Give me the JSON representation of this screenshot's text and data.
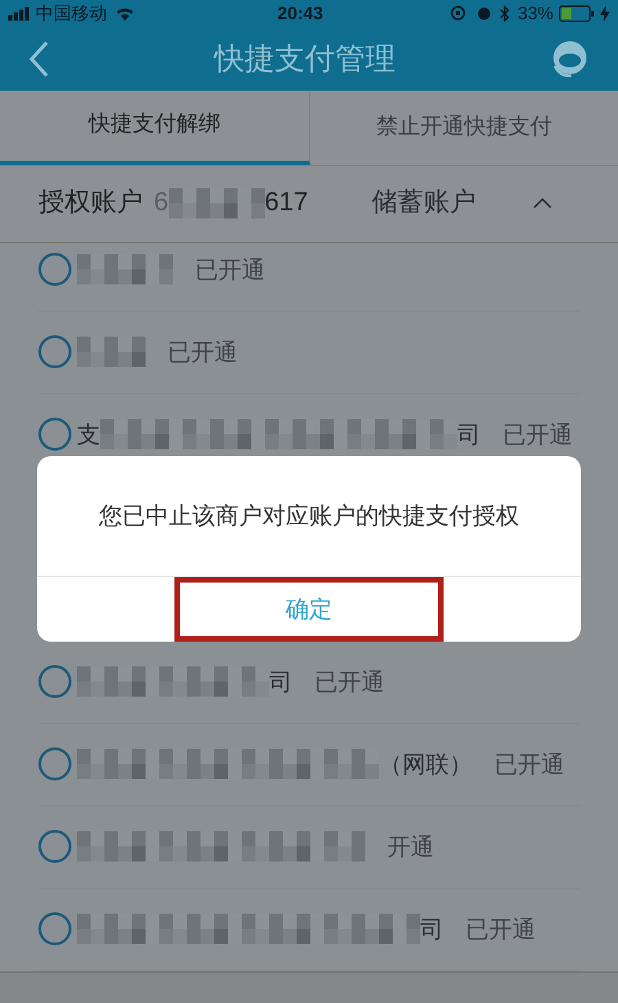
{
  "status_bar": {
    "carrier": "中国移动",
    "time": "20:43",
    "battery": "33%"
  },
  "header": {
    "title": "快捷支付管理"
  },
  "tabs": [
    {
      "label": "快捷支付解绑",
      "selected": true
    },
    {
      "label": "禁止开通快捷支付",
      "selected": false
    }
  ],
  "account": {
    "label": "授权账户",
    "number_start": "6",
    "number_end": "617",
    "type": "储蓄账户",
    "expanded": true
  },
  "merchants": [
    {
      "kind": "row",
      "status": "已开通",
      "selected": false
    },
    {
      "kind": "row",
      "status": "已开通",
      "selected": false
    },
    {
      "kind": "row",
      "name_start": "支",
      "name_end": "司",
      "status": "已开通",
      "selected": false
    },
    {
      "kind": "hidden"
    },
    {
      "kind": "hidden"
    },
    {
      "kind": "row",
      "name_end": "司",
      "status": "已开通",
      "selected": false
    },
    {
      "kind": "row",
      "name_end": "（网联）",
      "status": "已开通",
      "selected": false
    },
    {
      "kind": "row",
      "status": "开通",
      "selected": false
    },
    {
      "kind": "row",
      "name_end": "司",
      "status": "已开通",
      "selected": false
    }
  ],
  "dialog": {
    "message": "您已中止该商户对应账户的快捷支付授权",
    "button": "确定",
    "highlighted": true
  }
}
